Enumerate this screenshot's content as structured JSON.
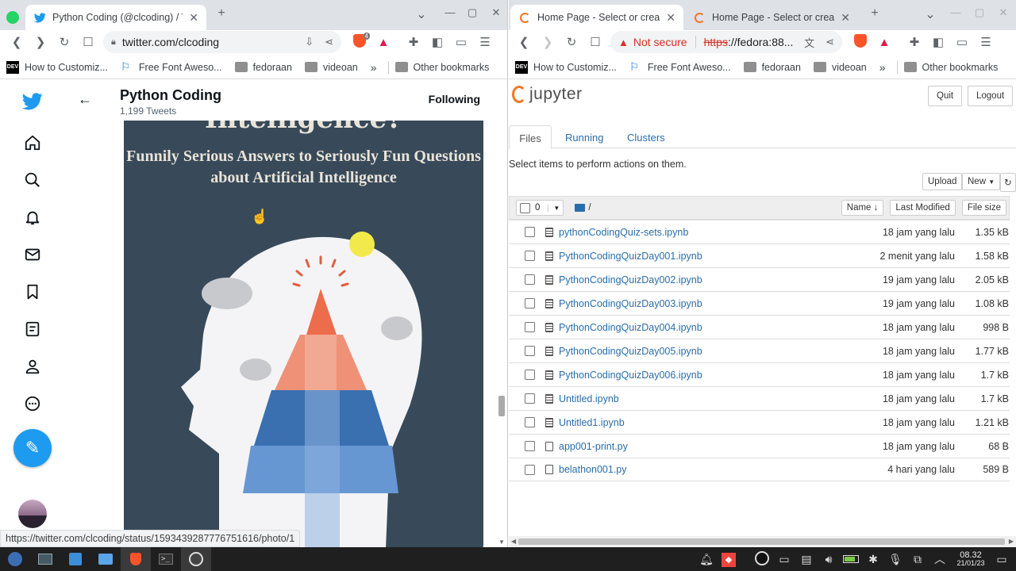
{
  "left_window": {
    "tabs": [
      {
        "title": "Python Coding (@clcoding) / T",
        "close": "✕"
      }
    ],
    "new_tab": "+",
    "window_controls": [
      "⌄",
      "—",
      "▢",
      "✕"
    ],
    "url": "twitter.com/clcoding",
    "bookmarks": [
      {
        "label": "How to Customiz...",
        "icon": "dev-icon"
      },
      {
        "label": "Free Font Aweso...",
        "icon": "flag-icon"
      },
      {
        "label": "fedoraan",
        "icon": "folder-icon"
      },
      {
        "label": "videoan",
        "icon": "folder-icon"
      }
    ],
    "bookmarks_more": "»",
    "other_bookmarks": "Other bookmarks",
    "brave_badge": "4",
    "twitter": {
      "profile_name": "Python Coding",
      "tweet_count": "1,199 Tweets",
      "following_label": "Following",
      "image_headline_partial": "Intelligence?",
      "image_subtitle_line1": "Funnily Serious Answers to Seriously Fun Questions",
      "image_subtitle_line2": "about Artificial Intelligence",
      "nav_icons": [
        "twitter-logo-icon",
        "home-icon",
        "explore-icon",
        "notifications-icon",
        "messages-icon",
        "bookmarks-icon",
        "lists-icon",
        "profile-icon",
        "more-icon"
      ],
      "accent": "#1d9bf0"
    },
    "status_url": "https://twitter.com/clcoding/status/1593439287776751616/photo/1"
  },
  "right_window": {
    "tabs": [
      {
        "title": "Home Page - Select or create",
        "close": "✕"
      },
      {
        "title": "Home Page - Select or create a n",
        "close": "✕"
      }
    ],
    "new_tab": "+",
    "not_secure": "Not secure",
    "url_https": "https",
    "url_rest": "://fedora:88...",
    "bookmarks": [
      {
        "label": "How to Customiz...",
        "icon": "dev-icon"
      },
      {
        "label": "Free Font Aweso...",
        "icon": "flag-icon"
      },
      {
        "label": "fedoraan",
        "icon": "folder-icon"
      },
      {
        "label": "videoan",
        "icon": "folder-icon"
      }
    ],
    "bookmarks_more": "»",
    "other_bookmarks": "Other bookmarks",
    "jupyter": {
      "logo_text": "jupyter",
      "quit": "Quit",
      "logout": "Logout",
      "tabs": [
        "Files",
        "Running",
        "Clusters"
      ],
      "info": "Select items to perform actions on them.",
      "upload": "Upload",
      "new": "New",
      "selected_count": "0",
      "path": "/",
      "col_name": "Name",
      "col_modified": "Last Modified",
      "col_size": "File size",
      "link_color": "#296eaa",
      "files": [
        {
          "name": "pythonCodingQuiz-sets.ipynb",
          "modified": "18 jam yang lalu",
          "size": "1.35 kB",
          "type": "notebook"
        },
        {
          "name": "PythonCodingQuizDay001.ipynb",
          "modified": "2 menit yang lalu",
          "size": "1.58 kB",
          "type": "notebook"
        },
        {
          "name": "PythonCodingQuizDay002.ipynb",
          "modified": "19 jam yang lalu",
          "size": "2.05 kB",
          "type": "notebook"
        },
        {
          "name": "PythonCodingQuizDay003.ipynb",
          "modified": "19 jam yang lalu",
          "size": "1.08 kB",
          "type": "notebook"
        },
        {
          "name": "PythonCodingQuizDay004.ipynb",
          "modified": "18 jam yang lalu",
          "size": "998 B",
          "type": "notebook"
        },
        {
          "name": "PythonCodingQuizDay005.ipynb",
          "modified": "18 jam yang lalu",
          "size": "1.77 kB",
          "type": "notebook"
        },
        {
          "name": "PythonCodingQuizDay006.ipynb",
          "modified": "18 jam yang lalu",
          "size": "1.7 kB",
          "type": "notebook"
        },
        {
          "name": "Untitled.ipynb",
          "modified": "18 jam yang lalu",
          "size": "1.7 kB",
          "type": "notebook"
        },
        {
          "name": "Untitled1.ipynb",
          "modified": "18 jam yang lalu",
          "size": "1.21 kB",
          "type": "notebook"
        },
        {
          "name": "app001-print.py",
          "modified": "18 jam yang lalu",
          "size": "68 B",
          "type": "file"
        },
        {
          "name": "belathon001.py",
          "modified": "4 hari yang lalu",
          "size": "589 B",
          "type": "file"
        }
      ]
    }
  },
  "taskbar": {
    "apps": [
      "fedora-icon",
      "system-monitor-icon",
      "files-icon",
      "folder-icon",
      "brave-icon",
      "terminal-icon",
      "obs-icon"
    ],
    "tray": [
      "bell-icon",
      "anydesk-icon",
      "obs-tray-icon",
      "display-icon",
      "clipboard-icon",
      "volume-icon",
      "battery-icon",
      "bluetooth-icon",
      "microphone-icon",
      "screen-icon",
      "chevron-up-icon"
    ],
    "time": "08.32",
    "date": "21/01/23"
  }
}
